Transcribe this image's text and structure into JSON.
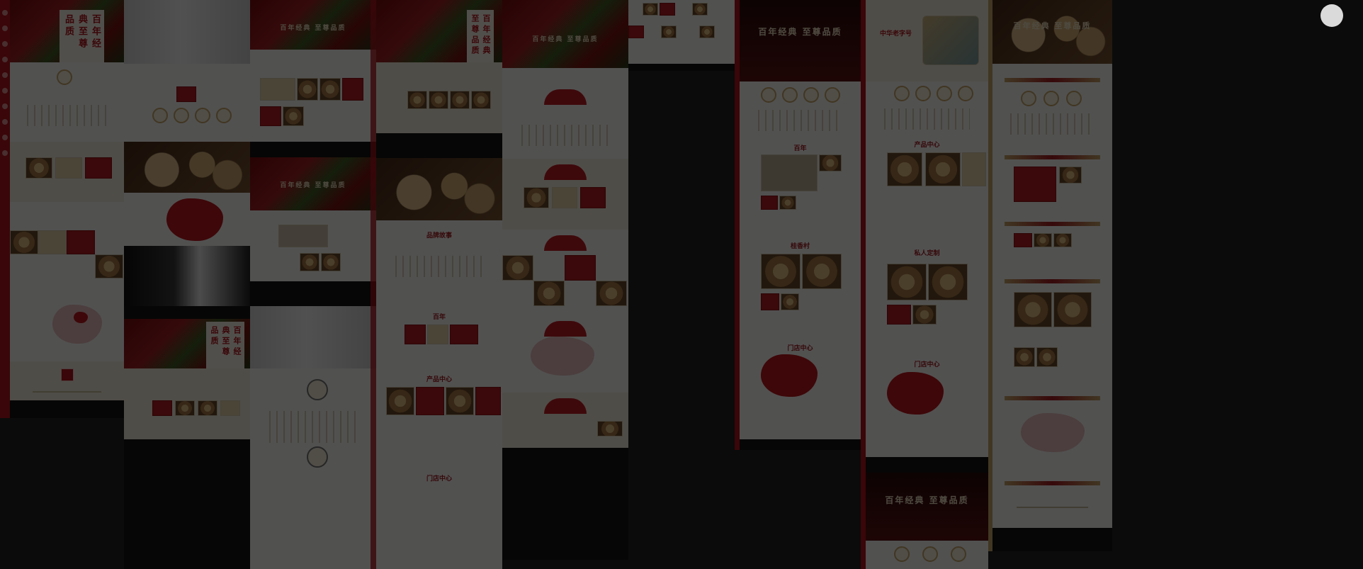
{
  "slogans": {
    "main": "百年经典  至尊品质",
    "center_motto": "百年经典  至尊品质",
    "heritage_badge": "中华老字号"
  },
  "vertical_titles": {
    "tile_a": "百年经典至尊品质",
    "tile_b": "百年经典至尊品质",
    "tile_c": "百年经典至尊品质",
    "tile_d": "百年经典至尊品质"
  },
  "section_titles": {
    "brand_story": "品牌故事",
    "history": "百年",
    "product": "产品中心",
    "stores": "门店中心",
    "guiyangxiang": "桂香村",
    "tailor": "私人定制"
  },
  "colors": {
    "brand_red": "#b3141d",
    "gold": "#c9a86a",
    "beige": "#f5efdf",
    "footer": "#151515",
    "overlay": "rgba(0,0,0,0.68)"
  }
}
